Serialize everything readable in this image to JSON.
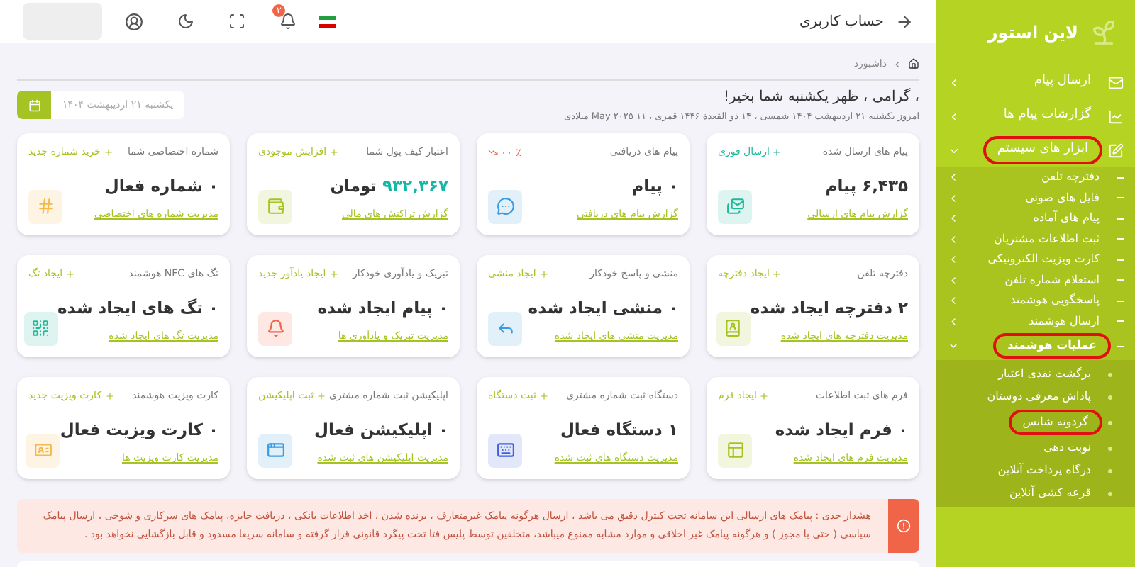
{
  "header": {
    "title": "حساب کاربری",
    "notifications": "۳"
  },
  "sidebar": {
    "brand": "لاین استور",
    "items": [
      {
        "label": "ارسال پیام",
        "expanded": false,
        "highlighted": false
      },
      {
        "label": "گزارشات پیام ها",
        "expanded": false,
        "highlighted": false
      },
      {
        "label": "ابزار های سیستم",
        "expanded": true,
        "highlighted": true,
        "children": [
          {
            "label": "دفترچه تلفن",
            "expanded": false,
            "highlighted": false
          },
          {
            "label": "فایل های صوتی",
            "expanded": false,
            "highlighted": false
          },
          {
            "label": "پیام های آماده",
            "expanded": false,
            "highlighted": false
          },
          {
            "label": "ثبت اطلاعات مشتریان",
            "expanded": false,
            "highlighted": false
          },
          {
            "label": "کارت ویزیت الکترونیکی",
            "expanded": false,
            "highlighted": false
          },
          {
            "label": "استعلام شماره تلفن",
            "expanded": false,
            "highlighted": false
          },
          {
            "label": "پاسخگویی هوشمند",
            "expanded": false,
            "highlighted": false
          },
          {
            "label": "ارسال هوشمند",
            "expanded": false,
            "highlighted": false
          },
          {
            "label": "عملیات هوشمند",
            "expanded": true,
            "highlighted": true,
            "children": [
              {
                "label": "برگشت نقدی اعتبار",
                "highlighted": false
              },
              {
                "label": "پاداش معرفی دوستان",
                "highlighted": false
              },
              {
                "label": "گردونه شانس",
                "highlighted": true
              },
              {
                "label": "نوبت دهی",
                "highlighted": false
              },
              {
                "label": "درگاه پرداخت آنلاین",
                "highlighted": false
              },
              {
                "label": "قرعه کشی آنلاین",
                "highlighted": false
              }
            ]
          }
        ]
      }
    ]
  },
  "breadcrumb": [
    "داشبورد"
  ],
  "greeting": "، گرامی ، ظهر یکشنبه شما بخیر!",
  "date_line": "امروز یکشنبه ۲۱ اردیبهشت ۱۴۰۴ شمسی ، ۱۴ ذو القعدة ۱۴۴۶ قمری ، ۱۱ May ۲۰۲۵ میلادی",
  "date_field": {
    "placeholder": "یکشنبه ۲۱ اردیبهشت ۱۴۰۴"
  },
  "cards": [
    {
      "title": "پیام های ارسال شده",
      "action": {
        "kind": "add",
        "label": "ارسال فوری",
        "color": "#1fb89a"
      },
      "value": "۶,۴۳۵ پیام",
      "link": "گزارش پیام های ارسالی",
      "color": "#1fb89a"
    },
    {
      "title": "پیام های دریافتی",
      "action": {
        "kind": "trend",
        "label": "٪ ۰۰",
        "color": "#f06548"
      },
      "value": "۰ پیام",
      "link": "گزارش پیام های دریافتی",
      "color": "#3b9be0"
    },
    {
      "title": "اعتبار کیف پول شما",
      "action": {
        "kind": "add",
        "label": "افزایش موجودی",
        "color": "#a5c323"
      },
      "amount": "۹۳۲,۳۶۷",
      "value": "تومان",
      "link": "گزارش تراکنش های مالی",
      "color": "#a5c323"
    },
    {
      "title": "شماره اختصاصی شما",
      "action": {
        "kind": "add",
        "label": "خرید شماره جدید",
        "color": "#a5c323"
      },
      "value": "۰ شماره فعال",
      "link": "مدیریت شماره های اختصاصی",
      "color": "#f7b84b"
    },
    {
      "title": "دفترچه تلفن",
      "action": {
        "kind": "add",
        "label": "ایجاد دفترچه",
        "color": "#a5c323"
      },
      "value": "۲ دفترچه ایجاد شده",
      "link": "مدیریت دفترچه های ایجاد شده",
      "color": "#a5c323"
    },
    {
      "title": "منشی و پاسخ خودکار",
      "action": {
        "kind": "add",
        "label": "ایجاد منشی",
        "color": "#a5c323"
      },
      "value": "۰ منشی ایجاد شده",
      "link": "مدیریت منشی های ایجاد شده",
      "color": "#3b9be0"
    },
    {
      "title": "تبریک و یادآوری خودکار",
      "action": {
        "kind": "add",
        "label": "ایجاد یادآور جدید",
        "color": "#a5c323"
      },
      "value": "۰ پیام ایجاد شده",
      "link": "مدیریت تبریک و یادآوری ها",
      "color": "#f06548"
    },
    {
      "title": "تگ های NFC هوشمند",
      "action": {
        "kind": "add",
        "label": "ایجاد تگ",
        "color": "#a5c323"
      },
      "value": "۰ تگ های ایجاد شده",
      "link": "مدیریت تگ های ایجاد شده",
      "color": "#1fb89a"
    },
    {
      "title": "فرم های ثبت اطلاعات",
      "action": {
        "kind": "add",
        "label": "ایجاد فرم",
        "color": "#a5c323"
      },
      "value": "۰ فرم ایجاد شده",
      "link": "مدیریت فرم های ایجاد شده",
      "color": "#a5c323"
    },
    {
      "title": "دستگاه ثبت شماره مشتری",
      "action": {
        "kind": "add",
        "label": "ثبت دستگاه",
        "color": "#a5c323"
      },
      "value": "۱ دستگاه فعال",
      "link": "مدیریت دستگاه های ثبت شده",
      "color": "#405ee0"
    },
    {
      "title": "اپلیکیشن ثبت شماره مشتری",
      "action": {
        "kind": "add",
        "label": "ثبت اپلیکیشن",
        "color": "#a5c323"
      },
      "value": "۰ اپلیکیشن فعال",
      "link": "مدیریت اپلیکیشن های ثبت شده",
      "color": "#3b9be0"
    },
    {
      "title": "کارت ویزیت هوشمند",
      "action": {
        "kind": "add",
        "label": "کارت ویزیت جدید",
        "color": "#a5c323"
      },
      "value": "۰ کارت ویزیت فعال",
      "link": "مدیریت کارت ویزیت ها",
      "color": "#f7b84b"
    }
  ],
  "alert": "هشدار جدی : پیامک های ارسالی این سامانه تحت کنترل دقیق می باشد ، ارسال هرگونه پیامک غیرمتعارف ، برنده شدن ، اخذ اطلاعات بانکی ، دریافت جایزه، پیامک های سرکاری و شوخی ، ارسال پیامک سیاسی ( حتی با مجوز ) و هرگونه پیامک غیر اخلاقی و موارد مشابه ممنوع میباشد، متخلفین توسط پلیس فتا تحت پیگرد قانونی قرار گرفته و سامانه سریعا مسدود و قابل بازگشایی نخواهد بود ."
}
